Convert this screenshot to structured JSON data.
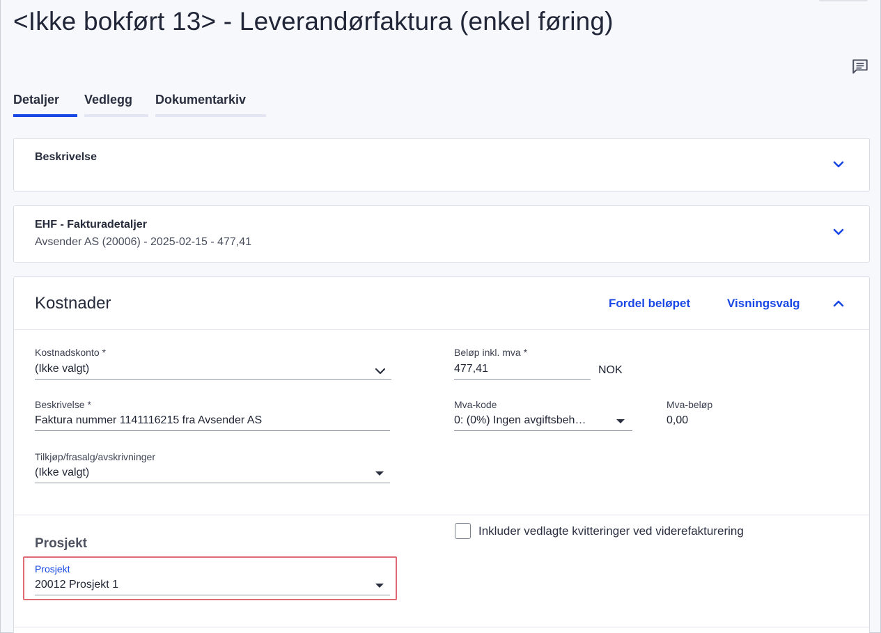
{
  "page": {
    "title": "<Ikke bokført 13> - Leverandørfaktura (enkel føring)"
  },
  "tabs": [
    {
      "label": "Detaljer",
      "active": true
    },
    {
      "label": "Vedlegg",
      "active": false
    },
    {
      "label": "Dokumentarkiv",
      "active": false
    }
  ],
  "beskrivelse_card": {
    "title": "Beskrivelse"
  },
  "ehf_card": {
    "title": "EHF - Fakturadetaljer",
    "summary": "Avsender AS (20006) - 2025-02-15 - 477,41"
  },
  "kostnader": {
    "title": "Kostnader",
    "fordel_link": "Fordel beløpet",
    "visningsvalg_link": "Visningsvalg",
    "kostnadskonto": {
      "label": "Kostnadskonto *",
      "value": "(Ikke valgt)"
    },
    "belop": {
      "label": "Beløp inkl. mva *",
      "value": "477,41",
      "currency": "NOK"
    },
    "beskrivelse": {
      "label": "Beskrivelse *",
      "value": "Faktura nummer 1141116215 fra Avsender AS"
    },
    "mva_kode": {
      "label": "Mva-kode",
      "value": "0: (0%) Ingen avgiftsbeh…"
    },
    "mva_belop": {
      "label": "Mva-beløp",
      "value": "0,00"
    },
    "tilkjop": {
      "label": "Tilkjøp/frasalg/avskrivninger",
      "value": "(Ikke valgt)"
    }
  },
  "prosjekt": {
    "heading": "Prosjekt",
    "checkbox_label": "Inkluder vedlagte kvitteringer ved viderefakturering",
    "checkbox_checked": false,
    "field_label": "Prosjekt",
    "field_value": "20012 Prosjekt 1"
  },
  "colors": {
    "accent": "#1947e5",
    "highlight": "#e06a72"
  }
}
